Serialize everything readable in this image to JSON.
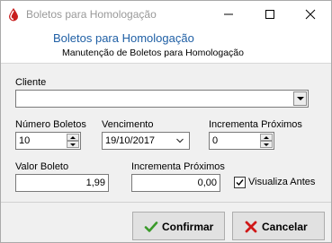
{
  "window": {
    "title": "Boletos para Homologação",
    "icon": "drop-icon",
    "controls": [
      "minimize-icon",
      "maximize-icon",
      "close-icon"
    ]
  },
  "header": {
    "title": "Boletos para Homologação",
    "subtitle": "Manutenção de Boletos para Homologação"
  },
  "form": {
    "cliente": {
      "label": "Cliente",
      "value": ""
    },
    "numero_boletos": {
      "label": "Número Boletos",
      "value": "10"
    },
    "vencimento": {
      "label": "Vencimento",
      "value": "19/10/2017"
    },
    "incrementa_proximos_1": {
      "label": "Incrementa Próximos",
      "value": "0"
    },
    "valor_boleto": {
      "label": "Valor Boleto",
      "value": "1,99"
    },
    "incrementa_proximos_2": {
      "label": "Incrementa Próximos",
      "value": "0,00"
    },
    "visualiza_antes": {
      "label": "Visualiza Antes",
      "checked": true
    }
  },
  "buttons": {
    "confirm": {
      "label": "Confirmar",
      "underline": "C"
    },
    "cancel": {
      "label": "Cancelar",
      "underline": "l"
    }
  },
  "colors": {
    "header_title": "#1f5fa5",
    "confirm_icon": "#3a9a2a",
    "cancel_icon": "#d01818"
  }
}
